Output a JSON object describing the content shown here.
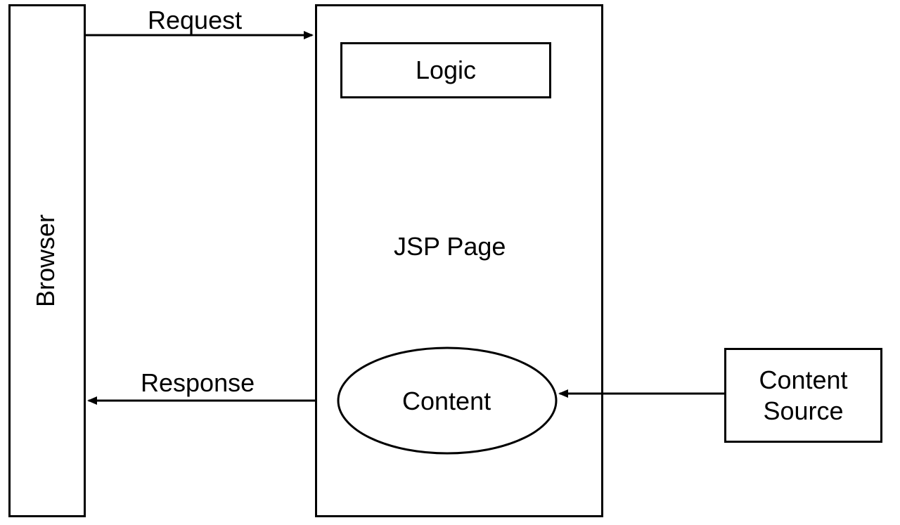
{
  "browser": {
    "label": "Browser"
  },
  "request": {
    "label": "Request"
  },
  "response": {
    "label": "Response"
  },
  "jsp": {
    "title": "JSP Page",
    "logic_label": "Logic",
    "content_label": "Content"
  },
  "content_source": {
    "line1": "Content",
    "line2": "Source"
  }
}
